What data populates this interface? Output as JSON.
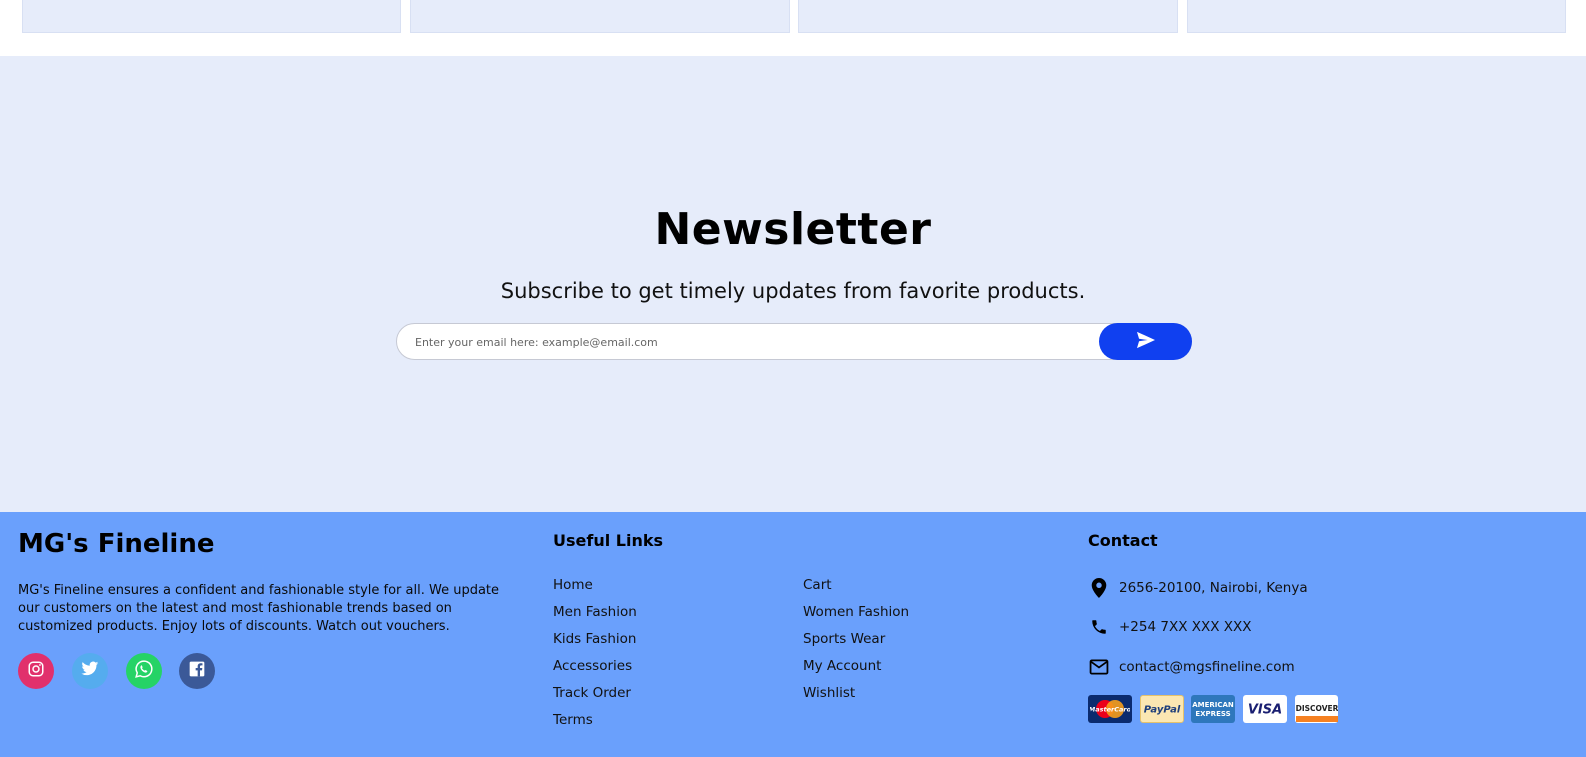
{
  "newsletter": {
    "title": "Newsletter",
    "subtitle": "Subscribe to get timely updates from favorite products.",
    "placeholder": "Enter your email here: example@email.com",
    "submit_icon": "send-icon"
  },
  "footer": {
    "brand": "MG's Fineline",
    "about": "MG's Fineline ensures a confident and fashionable style for all. We update our customers on the latest and most fashionable trends based on customized products. Enjoy lots of discounts. Watch out vouchers.",
    "socials": [
      {
        "icon": "instagram-icon",
        "color": "#e1306c"
      },
      {
        "icon": "twitter-icon",
        "color": "#55acee"
      },
      {
        "icon": "whatsapp-icon",
        "color": "#25d366"
      },
      {
        "icon": "facebook-icon",
        "color": "#3b5998"
      }
    ],
    "useful_links": {
      "title": "Useful Links",
      "col1": [
        "Home",
        "Men Fashion",
        "Kids Fashion",
        "Accessories",
        "Track Order",
        "Terms"
      ],
      "col2": [
        "Cart",
        "Women Fashion",
        "Sports Wear",
        "My Account",
        "Wishlist"
      ]
    },
    "contact": {
      "title": "Contact",
      "address": "2656-20100, Nairobi, Kenya",
      "phone": "+254 7XX XXX XXX",
      "email": "contact@mgsfineline.com"
    },
    "payments": [
      {
        "name": "MasterCard",
        "icon": "mastercard-icon"
      },
      {
        "name": "PayPal",
        "icon": "paypal-icon"
      },
      {
        "name": "AMERICAN EXPRESS",
        "icon": "amex-icon"
      },
      {
        "name": "VISA",
        "icon": "visa-icon"
      },
      {
        "name": "DISCOVER",
        "icon": "discover-icon"
      }
    ]
  },
  "colors": {
    "accent": "#1040f0",
    "footer_bg": "#6aa0fc",
    "newsletter_bg": "#e6ecfa"
  }
}
